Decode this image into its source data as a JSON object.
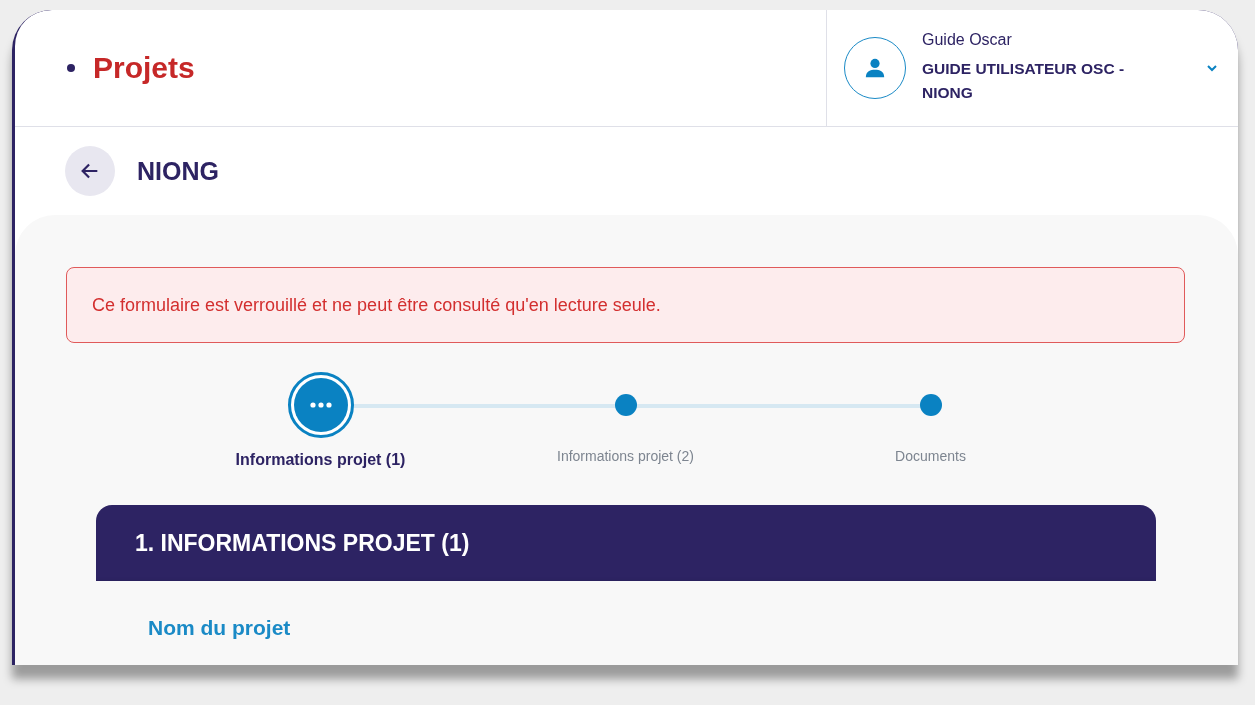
{
  "header": {
    "title": "Projets"
  },
  "user": {
    "name": "Guide Oscar",
    "organization": "GUIDE UTILISATEUR OSC - NIONG"
  },
  "page": {
    "title": "NIONG"
  },
  "alert": {
    "message": "Ce formulaire est verrouillé et ne peut être consulté qu'en lecture seule."
  },
  "steps": [
    {
      "label": "Informations projet (1)",
      "selected": true
    },
    {
      "label": "Informations projet (2)",
      "selected": false
    },
    {
      "label": "Documents",
      "selected": false
    }
  ],
  "section": {
    "title": "1. INFORMATIONS PROJET (1)",
    "field_label": "Nom du projet"
  }
}
